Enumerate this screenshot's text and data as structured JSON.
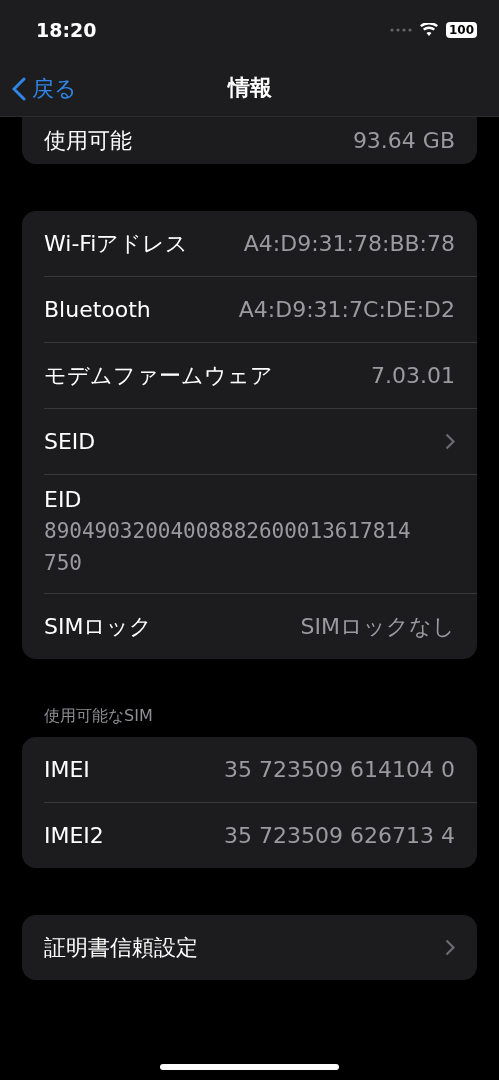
{
  "status_bar": {
    "time": "18:20",
    "battery": "100"
  },
  "nav": {
    "back": "戻る",
    "title": "情報"
  },
  "sections": [
    {
      "rows": [
        {
          "kind": "value",
          "label": "使用可能",
          "value": "93.64 GB"
        }
      ]
    },
    {
      "rows": [
        {
          "kind": "value",
          "label": "Wi-Fiアドレス",
          "value": "A4:D9:31:78:BB:78"
        },
        {
          "kind": "value",
          "label": "Bluetooth",
          "value": "A4:D9:31:7C:DE:D2"
        },
        {
          "kind": "value",
          "label": "モデムファームウェア",
          "value": "7.03.01"
        },
        {
          "kind": "chevron",
          "label": "SEID"
        },
        {
          "kind": "stacked",
          "label": "EID",
          "value": "89049032004008882600013617814750"
        },
        {
          "kind": "value",
          "label": "SIMロック",
          "value": "SIMロックなし"
        }
      ]
    },
    {
      "header": "使用可能なSIM",
      "rows": [
        {
          "kind": "value",
          "label": "IMEI",
          "value": "35 723509 614104 0"
        },
        {
          "kind": "value",
          "label": "IMEI2",
          "value": "35 723509 626713 4"
        }
      ]
    },
    {
      "rows": [
        {
          "kind": "chevron",
          "label": "証明書信頼設定"
        }
      ]
    }
  ]
}
